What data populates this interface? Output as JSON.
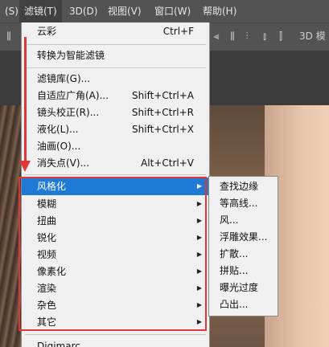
{
  "menubar": {
    "items": [
      {
        "label": "(S)"
      },
      {
        "label": "滤镜(T)"
      },
      {
        "label": "3D(D)"
      },
      {
        "label": "视图(V)"
      },
      {
        "label": "窗口(W)"
      },
      {
        "label": "帮助(H)"
      }
    ]
  },
  "optbar": {
    "label_3d": "3D 模"
  },
  "filter_menu": {
    "items": [
      {
        "label": "云彩",
        "shortcut": "Ctrl+F"
      },
      {
        "label": "转换为智能滤镜",
        "shortcut": ""
      },
      {
        "label": "滤镜库(G)...",
        "shortcut": ""
      },
      {
        "label": "自适应广角(A)...",
        "shortcut": "Shift+Ctrl+A"
      },
      {
        "label": "镜头校正(R)...",
        "shortcut": "Shift+Ctrl+R"
      },
      {
        "label": "液化(L)...",
        "shortcut": "Shift+Ctrl+X"
      },
      {
        "label": "油画(O)...",
        "shortcut": ""
      },
      {
        "label": "消失点(V)...",
        "shortcut": "Alt+Ctrl+V"
      }
    ],
    "submenu_groups": [
      {
        "label": "风格化"
      },
      {
        "label": "模糊"
      },
      {
        "label": "扭曲"
      },
      {
        "label": "锐化"
      },
      {
        "label": "视频"
      },
      {
        "label": "像素化"
      },
      {
        "label": "渲染"
      },
      {
        "label": "杂色"
      },
      {
        "label": "其它"
      }
    ],
    "partial_item": "Digimarc"
  },
  "stylize_submenu": {
    "items": [
      {
        "label": "查找边缘"
      },
      {
        "label": "等高线..."
      },
      {
        "label": "风..."
      },
      {
        "label": "浮雕效果..."
      },
      {
        "label": "扩散..."
      },
      {
        "label": "拼贴..."
      },
      {
        "label": "曝光过度"
      },
      {
        "label": "凸出..."
      }
    ]
  },
  "colors": {
    "highlight": "#1f7ad6",
    "annotation_red": "#e23636"
  }
}
